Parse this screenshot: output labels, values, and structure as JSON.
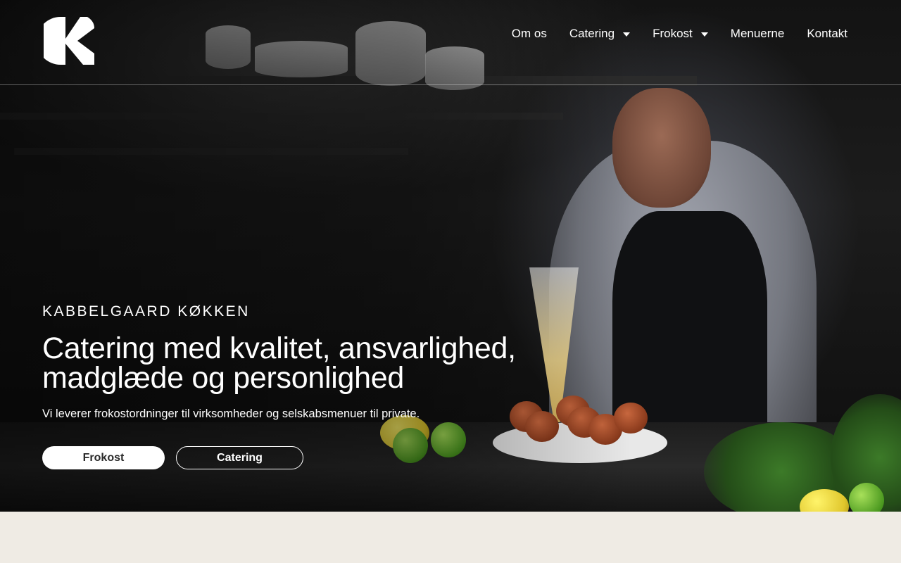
{
  "brand": {
    "logo_icon": "k-monogram-logo"
  },
  "nav": {
    "items": [
      {
        "label": "Om os",
        "dropdown": false
      },
      {
        "label": "Catering",
        "dropdown": true
      },
      {
        "label": "Frokost",
        "dropdown": true
      },
      {
        "label": "Menuerne",
        "dropdown": false
      },
      {
        "label": "Kontakt",
        "dropdown": false
      }
    ]
  },
  "hero": {
    "kicker": "KABBELGAARD KØKKEN",
    "headline_line1": "Catering med kvalitet, ansvarlighed,",
    "headline_line2": "madglæde og personlighed",
    "subtext": "Vi leverer frokostordninger til virksomheder og selskabsmenuer til private.",
    "buttons": {
      "primary_label": "Frokost",
      "secondary_label": "Catering"
    }
  },
  "colors": {
    "page_background": "#efebe4",
    "text_on_hero": "#ffffff",
    "primary_button_bg": "#ffffff",
    "primary_button_text": "#2a2a2a"
  }
}
